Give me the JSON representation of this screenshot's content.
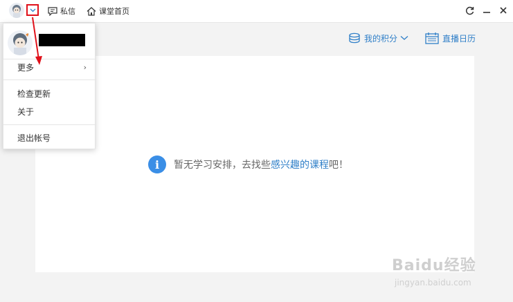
{
  "titlebar": {
    "messages_label": "私信",
    "home_label": "课堂首页"
  },
  "user_menu": {
    "items": [
      {
        "label": "更多"
      },
      {
        "label": "检查更新"
      },
      {
        "label": "关于"
      },
      {
        "label": "退出帐号"
      }
    ]
  },
  "toolbar": {
    "points_label": "我的积分",
    "calendar_label": "直播日历"
  },
  "empty_state": {
    "text_before": "暂无学习安排，去找些",
    "link_text": "感兴趣的课程",
    "text_after": "吧！"
  },
  "watermark": {
    "brand": "Baidu经验",
    "url": "jingyan.baidu.com"
  },
  "colors": {
    "accent": "#2f7fc8",
    "info_icon": "#3a8ee6",
    "annotation_red": "#e0101a"
  }
}
